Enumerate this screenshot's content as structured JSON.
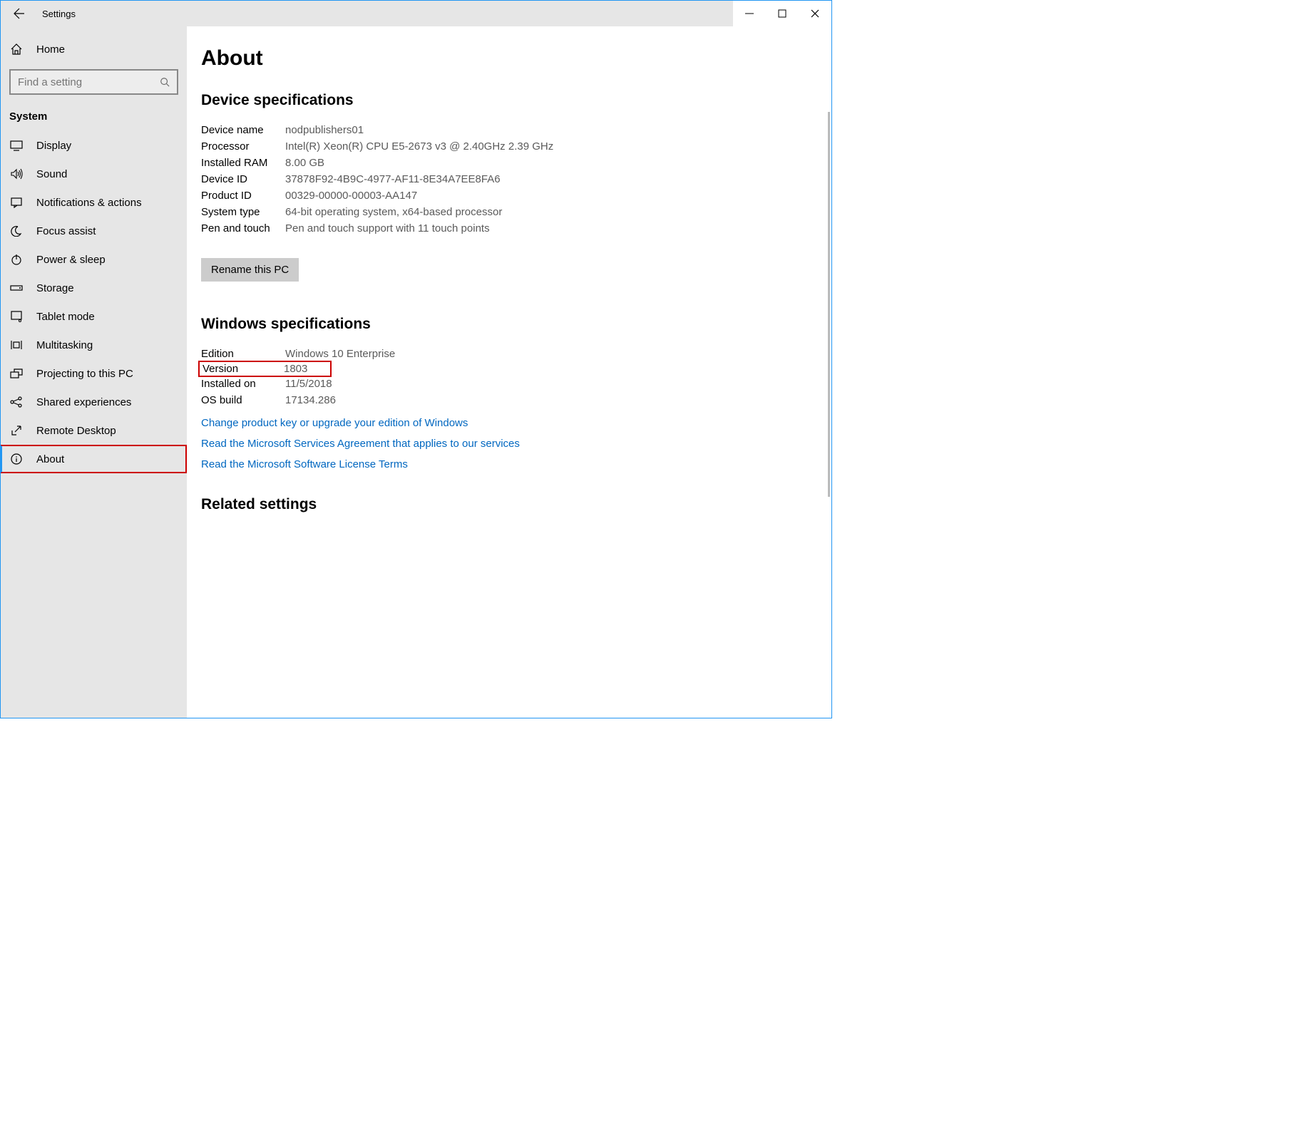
{
  "titlebar": {
    "title": "Settings"
  },
  "sidebar": {
    "home": "Home",
    "search_placeholder": "Find a setting",
    "category": "System",
    "items": [
      {
        "label": "Display"
      },
      {
        "label": "Sound"
      },
      {
        "label": "Notifications & actions"
      },
      {
        "label": "Focus assist"
      },
      {
        "label": "Power & sleep"
      },
      {
        "label": "Storage"
      },
      {
        "label": "Tablet mode"
      },
      {
        "label": "Multitasking"
      },
      {
        "label": "Projecting to this PC"
      },
      {
        "label": "Shared experiences"
      },
      {
        "label": "Remote Desktop"
      },
      {
        "label": "About"
      }
    ]
  },
  "page": {
    "title": "About",
    "device_section": {
      "heading": "Device specifications",
      "rows": [
        {
          "label": "Device name",
          "value": "nodpublishers01"
        },
        {
          "label": "Processor",
          "value": "Intel(R) Xeon(R) CPU E5-2673 v3 @ 2.40GHz 2.39 GHz"
        },
        {
          "label": "Installed RAM",
          "value": "8.00 GB"
        },
        {
          "label": "Device ID",
          "value": "37878F92-4B9C-4977-AF11-8E34A7EE8FA6"
        },
        {
          "label": "Product ID",
          "value": "00329-00000-00003-AA147"
        },
        {
          "label": "System type",
          "value": "64-bit operating system, x64-based processor"
        },
        {
          "label": "Pen and touch",
          "value": "Pen and touch support with 11 touch points"
        }
      ],
      "rename_btn": "Rename this PC"
    },
    "windows_section": {
      "heading": "Windows specifications",
      "rows": [
        {
          "label": "Edition",
          "value": "Windows 10 Enterprise"
        },
        {
          "label": "Version",
          "value": "1803"
        },
        {
          "label": "Installed on",
          "value": "11/5/2018"
        },
        {
          "label": "OS build",
          "value": "17134.286"
        }
      ],
      "links": [
        "Change product key or upgrade your edition of Windows",
        "Read the Microsoft Services Agreement that applies to our services",
        "Read the Microsoft Software License Terms"
      ]
    },
    "related_heading": "Related settings"
  }
}
